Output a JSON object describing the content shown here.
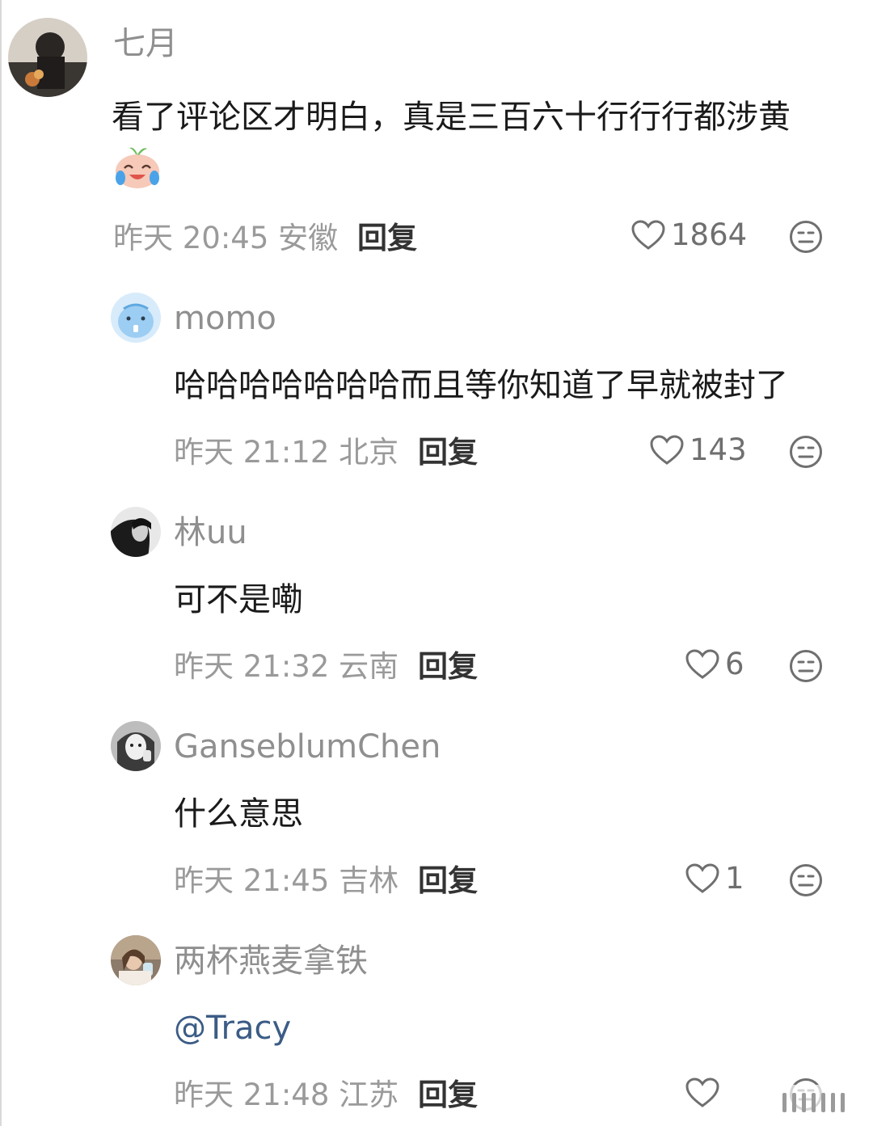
{
  "comments": [
    {
      "user": "七月",
      "text_line1": "看了评论区才明白，真是三百六十行行行都涉黄",
      "emoji": "laughing-crying-emoji",
      "time": "昨天 20:45 安徽",
      "reply": "回复",
      "likes": "1864"
    },
    {
      "user": "momo",
      "text": "哈哈哈哈哈哈哈而且等你知道了早就被封了",
      "time": "昨天 21:12 北京",
      "reply": "回复",
      "likes": "143"
    },
    {
      "user": "林uu",
      "text": "可不是嘞",
      "time": "昨天 21:32 云南",
      "reply": "回复",
      "likes": "6"
    },
    {
      "user": "GanseblumChen",
      "text": "什么意思",
      "time": "昨天 21:45 吉林",
      "reply": "回复",
      "likes": "1"
    },
    {
      "user": "两杯燕麦拿铁",
      "text": "@Tracy",
      "time": "昨天 21:48 江苏",
      "reply": "回复",
      "likes": ""
    }
  ],
  "icons": {
    "like": "heart-outline-icon",
    "dislike": "meh-face-icon"
  },
  "colors": {
    "username": "#8f8f8f",
    "body_text": "#1a1a1a",
    "meta": "#9a9a9a",
    "mention": "#3b5c86"
  }
}
